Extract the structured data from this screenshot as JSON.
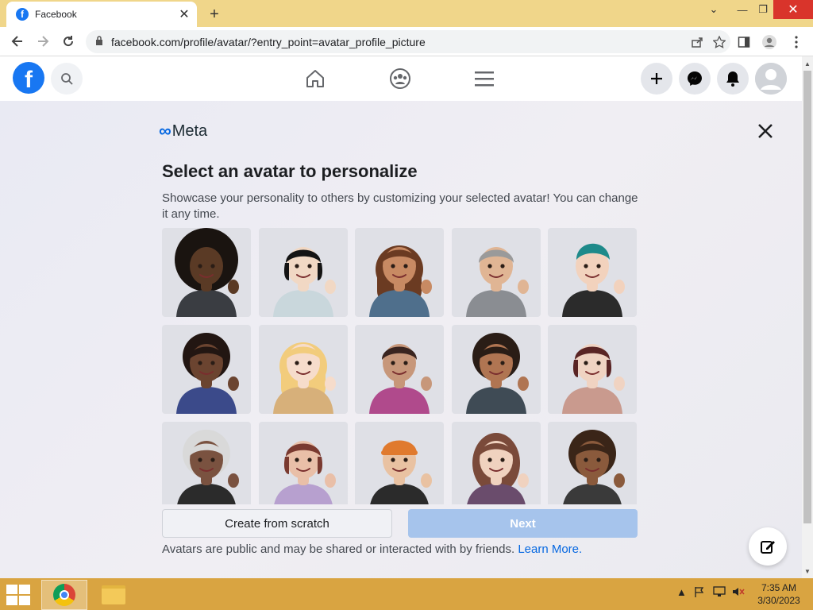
{
  "browser": {
    "tab_title": "Facebook",
    "tab_icon": "facebook-favicon",
    "tab_close": "✕",
    "new_tab": "+",
    "url": "facebook.com/profile/avatar/?entry_point=avatar_profile_picture",
    "window_controls": [
      "⌄",
      "—",
      "❐",
      "✕"
    ]
  },
  "fb_header": {
    "logo": "f",
    "nav_icons": [
      "home-icon",
      "groups-icon",
      "menu-icon"
    ],
    "right_icons": [
      "create-icon",
      "messenger-icon",
      "notifications-icon",
      "account-icon"
    ]
  },
  "main": {
    "brand": "Meta",
    "title": "Select an avatar to personalize",
    "description": "Showcase your personality to others by customizing your selected avatar! You can change it any time.",
    "avatars": [
      {
        "hair": "#1a1410",
        "skin": "#5a3a25",
        "shirt": "#3a3d42",
        "style": "afro"
      },
      {
        "hair": "#141414",
        "skin": "#f1d8c4",
        "shirt": "#c9d7dc",
        "style": "bob"
      },
      {
        "hair": "#6b3b22",
        "skin": "#c88a63",
        "shirt": "#4f6f8c",
        "style": "long"
      },
      {
        "hair": "#9a9a9a",
        "skin": "#e0b594",
        "shirt": "#8a8d92",
        "style": "short"
      },
      {
        "hair": "#1e8a8a",
        "skin": "#f2d2bd",
        "shirt": "#2b2b2b",
        "style": "mohawk"
      },
      {
        "hair": "#221612",
        "skin": "#6b4430",
        "shirt": "#3b4a8a",
        "style": "braids"
      },
      {
        "hair": "#f2cc7c",
        "skin": "#f6dccb",
        "shirt": "#d7b07a",
        "style": "long"
      },
      {
        "hair": "#3a2520",
        "skin": "#c7977a",
        "shirt": "#b04a8c",
        "style": "short"
      },
      {
        "hair": "#2a1d16",
        "skin": "#b07552",
        "shirt": "#3f4b55",
        "style": "curly"
      },
      {
        "hair": "#5a2525",
        "skin": "#f0d3c2",
        "shirt": "#c99a8e",
        "style": "bob"
      },
      {
        "hair": "#d9d9d9",
        "skin": "#7a5240",
        "shirt": "#2b2b2b",
        "style": "curly"
      },
      {
        "hair": "#7a3a30",
        "skin": "#e9bfa8",
        "shirt": "#b7a0cf",
        "style": "bob"
      },
      {
        "hair": "#e07a2e",
        "skin": "#e9c2a2",
        "shirt": "#2b2b2b",
        "style": "cap"
      },
      {
        "hair": "#7a4a3a",
        "skin": "#f0d2bf",
        "shirt": "#6a4c6c",
        "style": "hijab"
      },
      {
        "hair": "#3a2518",
        "skin": "#8a5a3c",
        "shirt": "#3a3a3a",
        "style": "ponytail"
      }
    ],
    "create_button": "Create from scratch",
    "next_button": "Next",
    "footer_text": "Avatars are public and may be shared or interacted with by friends.",
    "footer_link": "Learn More."
  },
  "taskbar": {
    "clock_time": "7:35 AM",
    "clock_date": "3/30/2023"
  },
  "colors": {
    "brand_blue": "#1877f2",
    "meta_blue": "#0668e1",
    "next_disabled": "#a6c4ec",
    "taskbar": "#d9a441",
    "tabbar": "#f0d68a"
  }
}
